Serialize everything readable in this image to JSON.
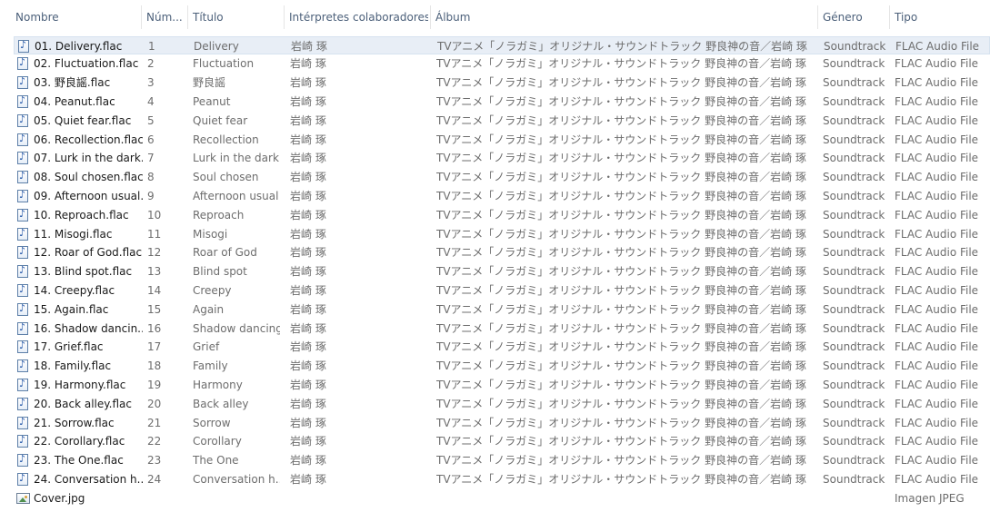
{
  "columns": [
    {
      "key": "name",
      "label": "Nombre"
    },
    {
      "key": "num",
      "label": "Núm..."
    },
    {
      "key": "title",
      "label": "Título"
    },
    {
      "key": "artist",
      "label": "Intérpretes colaboradores"
    },
    {
      "key": "album",
      "label": "Álbum"
    },
    {
      "key": "genre",
      "label": "Género"
    },
    {
      "key": "type",
      "label": "Tipo"
    }
  ],
  "selected_index": 0,
  "files": [
    {
      "name": "01. Delivery.flac",
      "num": "1",
      "title": "Delivery",
      "artist": "岩崎 琢",
      "album": "TVアニメ「ノラガミ」オリジナル・サウンドトラック 野良神の音／岩崎 琢",
      "genre": "Soundtrack",
      "type": "FLAC Audio File",
      "icon": "audio-file-icon"
    },
    {
      "name": "02. Fluctuation.flac",
      "num": "2",
      "title": "Fluctuation",
      "artist": "岩崎 琢",
      "album": "TVアニメ「ノラガミ」オリジナル・サウンドトラック 野良神の音／岩崎 琢",
      "genre": "Soundtrack",
      "type": "FLAC Audio File",
      "icon": "audio-file-icon"
    },
    {
      "name": "03. 野良謡.flac",
      "num": "3",
      "title": "野良謡",
      "artist": "岩崎 琢",
      "album": "TVアニメ「ノラガミ」オリジナル・サウンドトラック 野良神の音／岩崎 琢",
      "genre": "Soundtrack",
      "type": "FLAC Audio File",
      "icon": "audio-file-icon"
    },
    {
      "name": "04. Peanut.flac",
      "num": "4",
      "title": "Peanut",
      "artist": "岩崎 琢",
      "album": "TVアニメ「ノラガミ」オリジナル・サウンドトラック 野良神の音／岩崎 琢",
      "genre": "Soundtrack",
      "type": "FLAC Audio File",
      "icon": "audio-file-icon"
    },
    {
      "name": "05. Quiet fear.flac",
      "num": "5",
      "title": "Quiet fear",
      "artist": "岩崎 琢",
      "album": "TVアニメ「ノラガミ」オリジナル・サウンドトラック 野良神の音／岩崎 琢",
      "genre": "Soundtrack",
      "type": "FLAC Audio File",
      "icon": "audio-file-icon"
    },
    {
      "name": "06. Recollection.flac",
      "num": "6",
      "title": "Recollection",
      "artist": "岩崎 琢",
      "album": "TVアニメ「ノラガミ」オリジナル・サウンドトラック 野良神の音／岩崎 琢",
      "genre": "Soundtrack",
      "type": "FLAC Audio File",
      "icon": "audio-file-icon"
    },
    {
      "name": "07. Lurk in the dark....",
      "num": "7",
      "title": "Lurk in the dark",
      "artist": "岩崎 琢",
      "album": "TVアニメ「ノラガミ」オリジナル・サウンドトラック 野良神の音／岩崎 琢",
      "genre": "Soundtrack",
      "type": "FLAC Audio File",
      "icon": "audio-file-icon"
    },
    {
      "name": "08. Soul chosen.flac",
      "num": "8",
      "title": "Soul chosen",
      "artist": "岩崎 琢",
      "album": "TVアニメ「ノラガミ」オリジナル・サウンドトラック 野良神の音／岩崎 琢",
      "genre": "Soundtrack",
      "type": "FLAC Audio File",
      "icon": "audio-file-icon"
    },
    {
      "name": "09. Afternoon usual...",
      "num": "9",
      "title": "Afternoon usual",
      "artist": "岩崎 琢",
      "album": "TVアニメ「ノラガミ」オリジナル・サウンドトラック 野良神の音／岩崎 琢",
      "genre": "Soundtrack",
      "type": "FLAC Audio File",
      "icon": "audio-file-icon"
    },
    {
      "name": "10. Reproach.flac",
      "num": "10",
      "title": "Reproach",
      "artist": "岩崎 琢",
      "album": "TVアニメ「ノラガミ」オリジナル・サウンドトラック 野良神の音／岩崎 琢",
      "genre": "Soundtrack",
      "type": "FLAC Audio File",
      "icon": "audio-file-icon"
    },
    {
      "name": "11. Misogi.flac",
      "num": "11",
      "title": "Misogi",
      "artist": "岩崎 琢",
      "album": "TVアニメ「ノラガミ」オリジナル・サウンドトラック 野良神の音／岩崎 琢",
      "genre": "Soundtrack",
      "type": "FLAC Audio File",
      "icon": "audio-file-icon"
    },
    {
      "name": "12. Roar of God.flac",
      "num": "12",
      "title": "Roar of God",
      "artist": "岩崎 琢",
      "album": "TVアニメ「ノラガミ」オリジナル・サウンドトラック 野良神の音／岩崎 琢",
      "genre": "Soundtrack",
      "type": "FLAC Audio File",
      "icon": "audio-file-icon"
    },
    {
      "name": "13. Blind spot.flac",
      "num": "13",
      "title": "Blind spot",
      "artist": "岩崎 琢",
      "album": "TVアニメ「ノラガミ」オリジナル・サウンドトラック 野良神の音／岩崎 琢",
      "genre": "Soundtrack",
      "type": "FLAC Audio File",
      "icon": "audio-file-icon"
    },
    {
      "name": "14. Creepy.flac",
      "num": "14",
      "title": "Creepy",
      "artist": "岩崎 琢",
      "album": "TVアニメ「ノラガミ」オリジナル・サウンドトラック 野良神の音／岩崎 琢",
      "genre": "Soundtrack",
      "type": "FLAC Audio File",
      "icon": "audio-file-icon"
    },
    {
      "name": "15. Again.flac",
      "num": "15",
      "title": "Again",
      "artist": "岩崎 琢",
      "album": "TVアニメ「ノラガミ」オリジナル・サウンドトラック 野良神の音／岩崎 琢",
      "genre": "Soundtrack",
      "type": "FLAC Audio File",
      "icon": "audio-file-icon"
    },
    {
      "name": "16. Shadow dancin...",
      "num": "16",
      "title": "Shadow dancing",
      "artist": "岩崎 琢",
      "album": "TVアニメ「ノラガミ」オリジナル・サウンドトラック 野良神の音／岩崎 琢",
      "genre": "Soundtrack",
      "type": "FLAC Audio File",
      "icon": "audio-file-icon"
    },
    {
      "name": "17. Grief.flac",
      "num": "17",
      "title": "Grief",
      "artist": "岩崎 琢",
      "album": "TVアニメ「ノラガミ」オリジナル・サウンドトラック 野良神の音／岩崎 琢",
      "genre": "Soundtrack",
      "type": "FLAC Audio File",
      "icon": "audio-file-icon"
    },
    {
      "name": "18. Family.flac",
      "num": "18",
      "title": "Family",
      "artist": "岩崎 琢",
      "album": "TVアニメ「ノラガミ」オリジナル・サウンドトラック 野良神の音／岩崎 琢",
      "genre": "Soundtrack",
      "type": "FLAC Audio File",
      "icon": "audio-file-icon"
    },
    {
      "name": "19. Harmony.flac",
      "num": "19",
      "title": "Harmony",
      "artist": "岩崎 琢",
      "album": "TVアニメ「ノラガミ」オリジナル・サウンドトラック 野良神の音／岩崎 琢",
      "genre": "Soundtrack",
      "type": "FLAC Audio File",
      "icon": "audio-file-icon"
    },
    {
      "name": "20. Back alley.flac",
      "num": "20",
      "title": "Back alley",
      "artist": "岩崎 琢",
      "album": "TVアニメ「ノラガミ」オリジナル・サウンドトラック 野良神の音／岩崎 琢",
      "genre": "Soundtrack",
      "type": "FLAC Audio File",
      "icon": "audio-file-icon"
    },
    {
      "name": "21. Sorrow.flac",
      "num": "21",
      "title": "Sorrow",
      "artist": "岩崎 琢",
      "album": "TVアニメ「ノラガミ」オリジナル・サウンドトラック 野良神の音／岩崎 琢",
      "genre": "Soundtrack",
      "type": "FLAC Audio File",
      "icon": "audio-file-icon"
    },
    {
      "name": "22. Corollary.flac",
      "num": "22",
      "title": "Corollary",
      "artist": "岩崎 琢",
      "album": "TVアニメ「ノラガミ」オリジナル・サウンドトラック 野良神の音／岩崎 琢",
      "genre": "Soundtrack",
      "type": "FLAC Audio File",
      "icon": "audio-file-icon"
    },
    {
      "name": "23. The One.flac",
      "num": "23",
      "title": "The One",
      "artist": "岩崎 琢",
      "album": "TVアニメ「ノラガミ」オリジナル・サウンドトラック 野良神の音／岩崎 琢",
      "genre": "Soundtrack",
      "type": "FLAC Audio File",
      "icon": "audio-file-icon"
    },
    {
      "name": "24. Conversation h...",
      "num": "24",
      "title": "Conversation h...",
      "artist": "岩崎 琢",
      "album": "TVアニメ「ノラガミ」オリジナル・サウンドトラック 野良神の音／岩崎 琢",
      "genre": "Soundtrack",
      "type": "FLAC Audio File",
      "icon": "audio-file-icon"
    },
    {
      "name": "Cover.jpg",
      "num": "",
      "title": "",
      "artist": "",
      "album": "",
      "genre": "",
      "type": "Imagen JPEG",
      "icon": "image-file-icon"
    }
  ]
}
